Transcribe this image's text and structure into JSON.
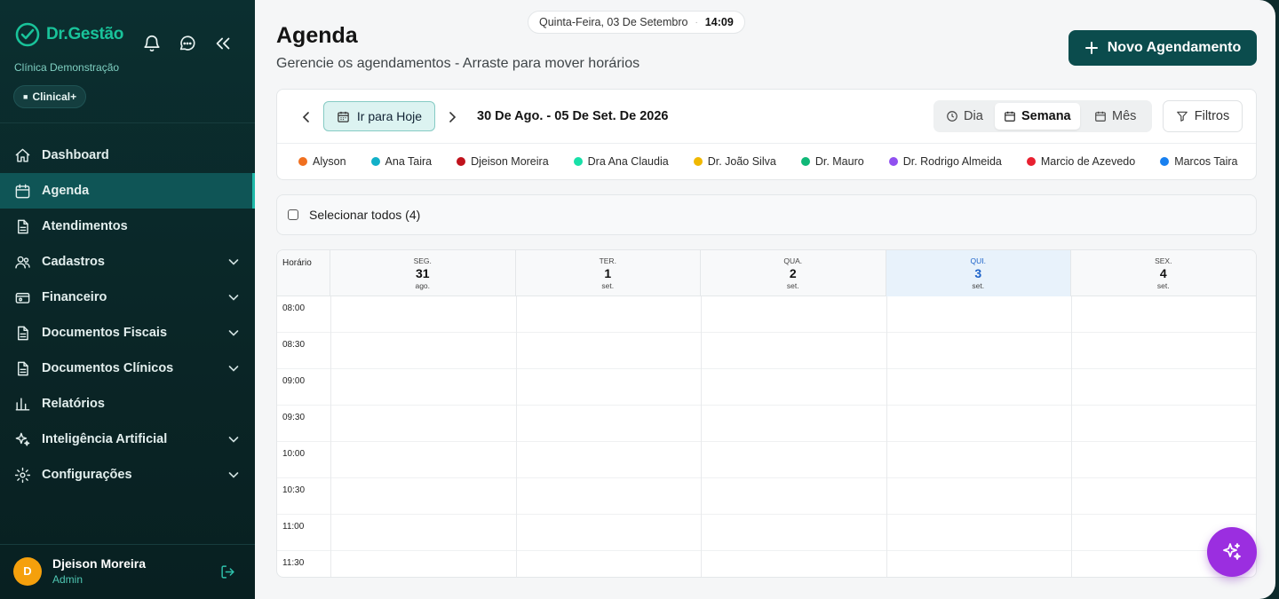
{
  "brand": {
    "name": "Dr.Gestão",
    "clinic": "Clínica Demonstração",
    "plan": "Clinical+",
    "plan_icon": "■"
  },
  "sidebar": {
    "items": [
      {
        "label": "Dashboard",
        "icon": "home-icon",
        "chevron": false,
        "active": false
      },
      {
        "label": "Agenda",
        "icon": "calendar-icon",
        "chevron": false,
        "active": true
      },
      {
        "label": "Atendimentos",
        "icon": "document-icon",
        "chevron": false,
        "active": false
      },
      {
        "label": "Cadastros",
        "icon": "users-icon",
        "chevron": true,
        "active": false
      },
      {
        "label": "Financeiro",
        "icon": "wallet-icon",
        "chevron": true,
        "active": false
      },
      {
        "label": "Documentos Fiscais",
        "icon": "document-icon",
        "chevron": true,
        "active": false
      },
      {
        "label": "Documentos Clínicos",
        "icon": "document-icon",
        "chevron": true,
        "active": false
      },
      {
        "label": "Relatórios",
        "icon": "bar-chart-icon",
        "chevron": false,
        "active": false
      },
      {
        "label": "Inteligência Artificial",
        "icon": "sparkles-icon",
        "chevron": true,
        "active": false
      },
      {
        "label": "Configurações",
        "icon": "gear-icon",
        "chevron": true,
        "active": false
      }
    ]
  },
  "user": {
    "initial": "D",
    "name": "Djeison Moreira",
    "role": "Admin"
  },
  "header": {
    "date": "Quinta-Feira, 03 De Setembro",
    "sep": "·",
    "time": "14:09",
    "title": "Agenda",
    "subtitle": "Gerencie os agendamentos - Arraste para mover horários",
    "new_button": "Novo Agendamento"
  },
  "toolbar": {
    "today": "Ir para Hoje",
    "range": "30 De Ago. - 05 De Set. De 2026",
    "views": [
      "Dia",
      "Semana",
      "Mês"
    ],
    "active_view": "Semana",
    "filters": "Filtros"
  },
  "legend": [
    {
      "name": "Alyson",
      "color": "#f07020"
    },
    {
      "name": "Ana Taira",
      "color": "#12b0c8"
    },
    {
      "name": "Djeison Moreira",
      "color": "#c0121c"
    },
    {
      "name": "Dra Ana Claudia",
      "color": "#18e0a8"
    },
    {
      "name": "Dr. João Silva",
      "color": "#f0b800"
    },
    {
      "name": "Dr. Mauro",
      "color": "#10b878"
    },
    {
      "name": "Dr. Rodrigo Almeida",
      "color": "#9050f0"
    },
    {
      "name": "Marcio de Azevedo",
      "color": "#e82030"
    },
    {
      "name": "Marcos Taira",
      "color": "#1880f0"
    }
  ],
  "select_all": "Selecionar todos (4)",
  "calendar": {
    "time_header": "Horário",
    "days": [
      {
        "weekday": "SEG.",
        "num": "31",
        "month": "ago.",
        "today": false
      },
      {
        "weekday": "TER.",
        "num": "1",
        "month": "set.",
        "today": false
      },
      {
        "weekday": "QUA.",
        "num": "2",
        "month": "set.",
        "today": false
      },
      {
        "weekday": "QUI.",
        "num": "3",
        "month": "set.",
        "today": true
      },
      {
        "weekday": "SEX.",
        "num": "4",
        "month": "set.",
        "today": false
      }
    ],
    "times": [
      "08:00",
      "08:30",
      "09:00",
      "09:30",
      "10:00",
      "10:30",
      "11:00",
      "11:30"
    ]
  },
  "colors": {
    "accent": "#0b4c4d",
    "brand": "#19c39a",
    "fab": "#9b2ee0",
    "today": "#1d63c9"
  }
}
